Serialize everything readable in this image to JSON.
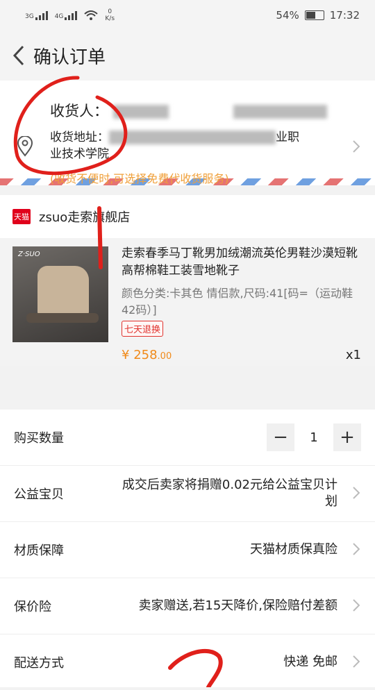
{
  "status_bar": {
    "net1": "3G",
    "net2": "4G",
    "speed": "0",
    "speed_unit": "K/s",
    "battery": "54%",
    "time": "17:32"
  },
  "header": {
    "title": "确认订单"
  },
  "address": {
    "consignee_label": "收货人：",
    "address_label": "收货地址：",
    "address_end": "业职",
    "address_line2": "业技术学院",
    "hint": "(收货不便时,可选择免费代收货服务)"
  },
  "shop": {
    "badge": "天猫",
    "name": "zsuo走索旗舰店"
  },
  "product": {
    "brand_mark": "Z·SUO",
    "title": "走索春季马丁靴男加绒潮流英伦男鞋沙漠短靴高帮棉鞋工装雪地靴子",
    "sku": "颜色分类:卡其色 情侣款,尺码:41[码=（运动鞋42码）]",
    "return_badge": "七天退换",
    "price_symbol": "¥",
    "price_int": "258",
    "price_dec": ".00",
    "quantity": "x1"
  },
  "rows": {
    "quantity_label": "购买数量",
    "quantity_value": "1",
    "minus": "−",
    "plus": "+",
    "charity_label": "公益宝贝",
    "charity_value_line1": "成交后卖家将捐赠0.02元给公益宝贝计",
    "charity_value_line2": "划",
    "material_label": "材质保障",
    "material_value": "天猫材质保真险",
    "price_protect_label": "保价险",
    "price_protect_value": "卖家赠送,若15天降价,保险赔付差额",
    "delivery_label": "配送方式",
    "delivery_value": "快递 免邮"
  }
}
